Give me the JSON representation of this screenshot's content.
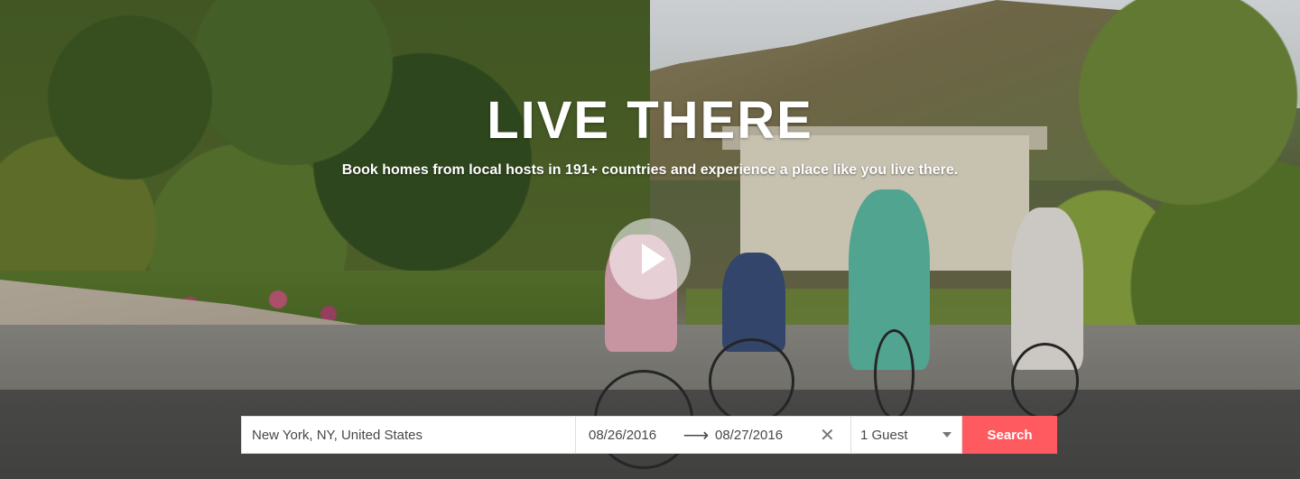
{
  "hero": {
    "title": "LIVE THERE",
    "subtitle": "Book homes from local hosts in 191+ countries and experience a place like you live there.",
    "play_icon": "play-icon"
  },
  "search": {
    "location_value": "New York, NY, United States",
    "checkin": "08/26/2016",
    "arrow_icon": "arrow-right-icon",
    "checkout": "08/27/2016",
    "clear_icon": "close-icon",
    "guests": "1 Guest",
    "guests_caret_icon": "caret-down-icon",
    "button_label": "Search",
    "button_color": "#ff5a5f"
  }
}
